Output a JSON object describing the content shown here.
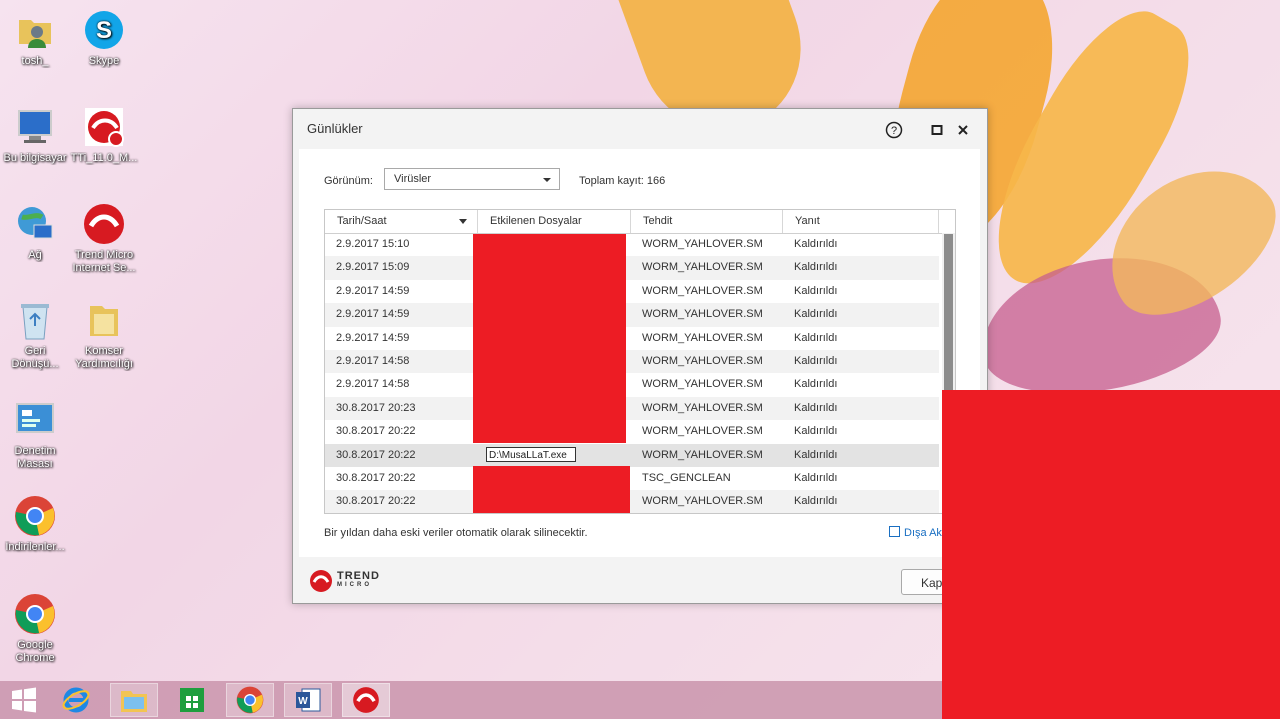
{
  "desktop": {
    "icons": [
      {
        "label": "tosh_"
      },
      {
        "label": "Skype"
      },
      {
        "label": "Bu bilgisayar"
      },
      {
        "label": "TTi_11.0_M..."
      },
      {
        "label": "Ağ"
      },
      {
        "label": "Trend Micro Internet Se..."
      },
      {
        "label": "Geri Dönüşü..."
      },
      {
        "label": "Komser Yardımcılığı"
      },
      {
        "label": "Denetim Masası"
      },
      {
        "label": "İndirilenler..."
      },
      {
        "label": "Google Chrome"
      }
    ]
  },
  "window": {
    "title": "Günlükler",
    "view_label": "Görünüm:",
    "view_value": "Virüsler",
    "total_label": "Toplam kayıt: 166",
    "columns": [
      "Tarih/Saat",
      "Etkilenen Dosyalar",
      "Tehdit",
      "Yanıt"
    ],
    "rows": [
      {
        "date": "2.9.2017 15:10",
        "threat": "WORM_YAHLOVER.SM",
        "response": "Kaldırıldı"
      },
      {
        "date": "2.9.2017 15:09",
        "threat": "WORM_YAHLOVER.SM",
        "response": "Kaldırıldı"
      },
      {
        "date": "2.9.2017 14:59",
        "threat": "WORM_YAHLOVER.SM",
        "response": "Kaldırıldı"
      },
      {
        "date": "2.9.2017 14:59",
        "threat": "WORM_YAHLOVER.SM",
        "response": "Kaldırıldı"
      },
      {
        "date": "2.9.2017 14:59",
        "threat": "WORM_YAHLOVER.SM",
        "response": "Kaldırıldı"
      },
      {
        "date": "2.9.2017 14:58",
        "threat": "WORM_YAHLOVER.SM",
        "response": "Kaldırıldı"
      },
      {
        "date": "2.9.2017 14:58",
        "threat": "WORM_YAHLOVER.SM",
        "response": "Kaldırıldı"
      },
      {
        "date": "30.8.2017 20:23",
        "threat": "WORM_YAHLOVER.SM",
        "response": "Kaldırıldı"
      },
      {
        "date": "30.8.2017 20:22",
        "threat": "WORM_YAHLOVER.SM",
        "response": "Kaldırıldı"
      },
      {
        "date": "30.8.2017 20:22",
        "file": "D:\\MusaLLaT.exe",
        "threat": "WORM_YAHLOVER.SM",
        "response": "Kaldırıldı"
      },
      {
        "date": "30.8.2017 20:22",
        "threat": "TSC_GENCLEAN",
        "response": "Kaldırıldı"
      },
      {
        "date": "30.8.2017 20:22",
        "threat": "WORM_YAHLOVER.SM",
        "response": "Kaldırıldı"
      }
    ],
    "note": "Bir yıldan daha eski veriler otomatik olarak silinecektir.",
    "export_label": "Dışa Ak",
    "close_label": "Kap",
    "logo_text_1": "TREND",
    "logo_text_2": "MICRO",
    "redaction_color": "#ed1c24"
  },
  "taskbar": {
    "items": [
      "start-button",
      "internet-explorer",
      "file-explorer",
      "store",
      "chrome",
      "word",
      "trend-micro"
    ]
  }
}
